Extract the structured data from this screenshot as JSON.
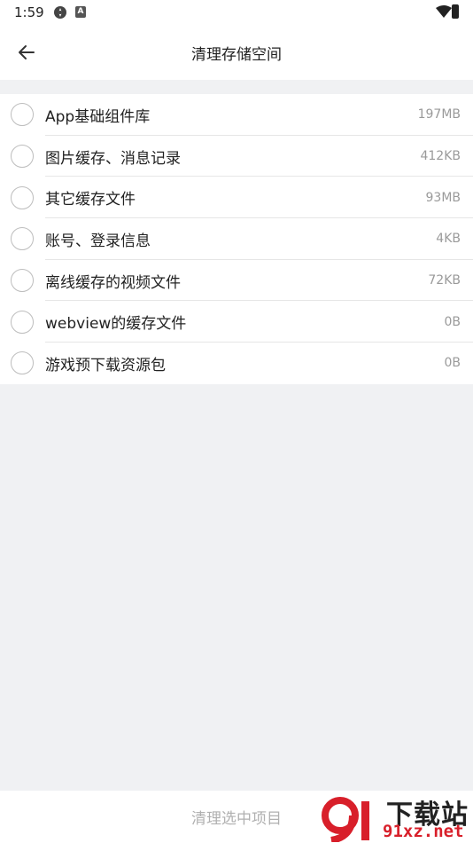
{
  "status_bar": {
    "time": "1:59",
    "icons": [
      "system-settings-icon",
      "app-notification-icon",
      "wifi-icon",
      "battery-charging-icon"
    ]
  },
  "header": {
    "title": "清理存储空间",
    "back_icon": "arrow-left-icon"
  },
  "items": [
    {
      "label": "App基础组件库",
      "size": "197MB",
      "checked": false
    },
    {
      "label": "图片缓存、消息记录",
      "size": "412KB",
      "checked": false
    },
    {
      "label": "其它缓存文件",
      "size": "93MB",
      "checked": false
    },
    {
      "label": "账号、登录信息",
      "size": "4KB",
      "checked": false
    },
    {
      "label": "离线缓存的视频文件",
      "size": "72KB",
      "checked": false
    },
    {
      "label": "webview的缓存文件",
      "size": "0B",
      "checked": false
    },
    {
      "label": "游戏预下载资源包",
      "size": "0B",
      "checked": false
    }
  ],
  "footer": {
    "clean_label": "清理选中项目"
  },
  "watermark": {
    "title": "下载站",
    "url": "91xz.net"
  },
  "colors": {
    "background": "#f0f1f3",
    "surface": "#ffffff",
    "secondary_text": "#9a9a9a",
    "disabled_text": "#b0b0b0",
    "watermark_red": "#d81f2a"
  }
}
